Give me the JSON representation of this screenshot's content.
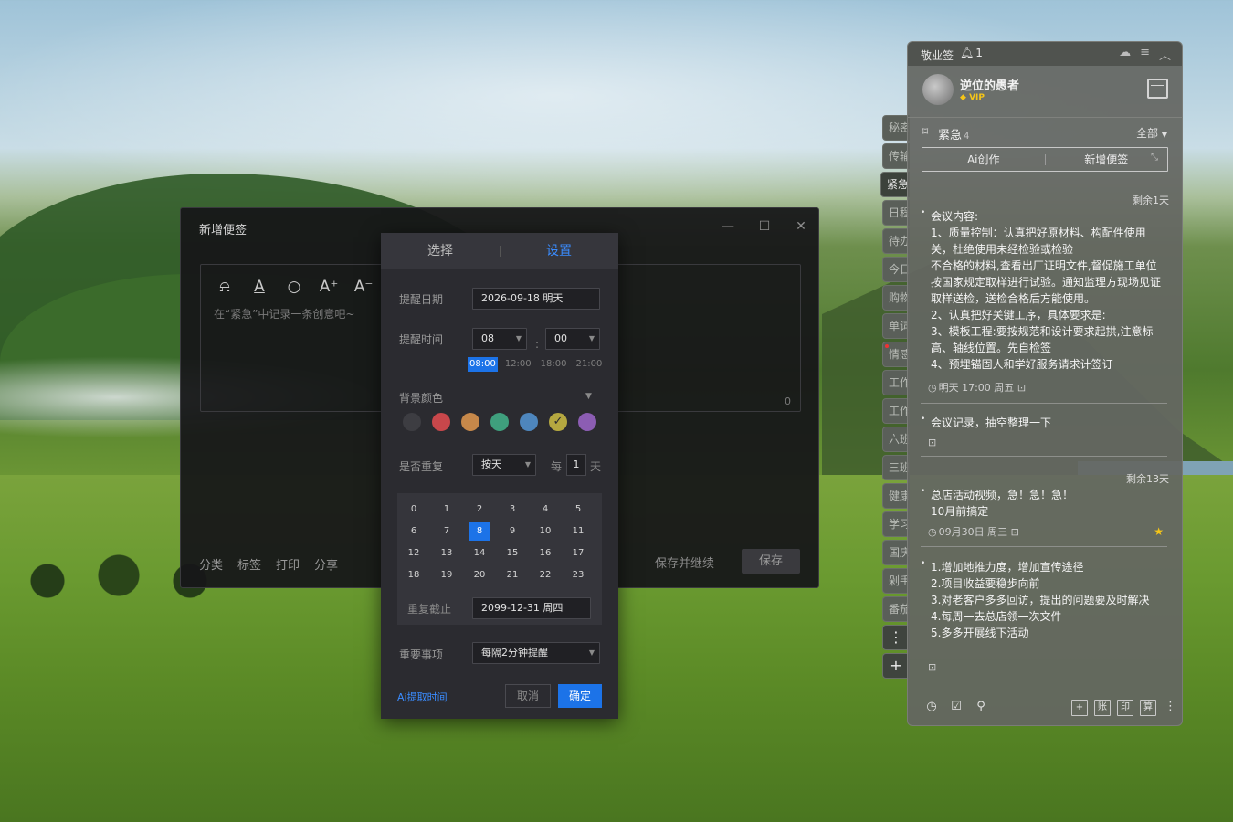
{
  "editor": {
    "title": "新增便签",
    "placeholder": "在“紧急”中记录一条创意吧~",
    "char_count": "0",
    "format_icons": [
      "bell-icon",
      "text-color-icon",
      "search-icon",
      "font-increase-icon",
      "font-decrease-icon"
    ],
    "format_glyphs": [
      "⍾",
      "A",
      "○",
      "A⁺",
      "A⁻"
    ],
    "footer": [
      "分类",
      "标签",
      "打印",
      "分享"
    ],
    "save_continue": "保存并继续",
    "save": "保存"
  },
  "popup": {
    "tabs": [
      "选择",
      "设置"
    ],
    "active_tab": "设置",
    "reminder_date_label": "提醒日期",
    "reminder_date": "2026-09-18 明天",
    "reminder_time_label": "提醒时间",
    "hour": "08",
    "minute": "00",
    "quick_times": [
      "08:00",
      "12:00",
      "18:00",
      "21:00"
    ],
    "selected_quick_time": "08:00",
    "bg_color_label": "背景颜色",
    "colors": [
      "#3d3d42",
      "#c8474b",
      "#c6884a",
      "#3f9f7d",
      "#4e86bd",
      "#b5a840",
      "#8c5db3"
    ],
    "selected_color": "#b5a840",
    "repeat_label": "是否重复",
    "repeat_mode": "按天",
    "repeat_every": "每",
    "repeat_interval": "1",
    "repeat_unit": "天",
    "days": [
      "0",
      "1",
      "2",
      "3",
      "4",
      "5",
      "6",
      "7",
      "8",
      "9",
      "10",
      "11",
      "12",
      "13",
      "14",
      "15",
      "16",
      "17",
      "18",
      "19",
      "20",
      "21",
      "22",
      "23"
    ],
    "selected_day": "8",
    "repeat_until_label": "重复截止",
    "repeat_until": "2099-12-31  周四",
    "important_label": "重要事项",
    "important_value": "每隔2分钟提醒",
    "ai_time": "Ai提取时间",
    "cancel": "取消",
    "ok": "确定"
  },
  "side_tabs": [
    "秘密",
    "传输",
    "紧急",
    "日程",
    "待办",
    "今日",
    "购物",
    "单词",
    "情感",
    "工作",
    "工作",
    "六班",
    "三班",
    "健康",
    "学习",
    "国庆",
    "剁手",
    "番茄"
  ],
  "side_active": "紧急",
  "side_more": "⋮",
  "side_add": "+",
  "panel": {
    "app_name": "敬业签",
    "bell_count": "1",
    "username": "逆位的愚者",
    "vip": "VIP",
    "category": "紧急",
    "category_count": "4",
    "filter": "全部",
    "ai_create": "Ai创作",
    "new_note": "新增便签",
    "notes": [
      {
        "remaining": "剩余1天",
        "lines": [
          "会议内容:",
          "1、质量控制：认真把好原材料、构配件使用关，杜绝使用未经检验或检验",
          "不合格的材料,查看出厂证明文件,督促施工单位按国家规定取样进行试验。通知监理方现场见证取样送检，送检合格后方能使用。",
          "2、认真把好关键工序，具体要求是:",
          "3、模板工程:要按规范和设计要求起拱,注意标高、轴线位置。先自检签",
          "4、预埋锚固人和学好服务请求计签订"
        ],
        "meta": "明天 17:00 周五"
      },
      {
        "remaining": "",
        "lines": [
          "会议记录，抽空整理一下"
        ],
        "meta": ""
      },
      {
        "remaining": "剩余13天",
        "lines": [
          "总店活动视频，急！急！急！",
          "10月前搞定"
        ],
        "meta": "09月30日 周三"
      },
      {
        "remaining": "",
        "lines": [
          "1.增加地推力度，增加宣传途径",
          "2.项目收益要稳步向前",
          "3.对老客户多多回访，提出的问题要及时解决",
          "4.每周一去总店领一次文件",
          "5.多多开展线下活动"
        ],
        "meta": ""
      }
    ],
    "footer_boxes": [
      "+",
      "账",
      "印",
      "算"
    ]
  }
}
